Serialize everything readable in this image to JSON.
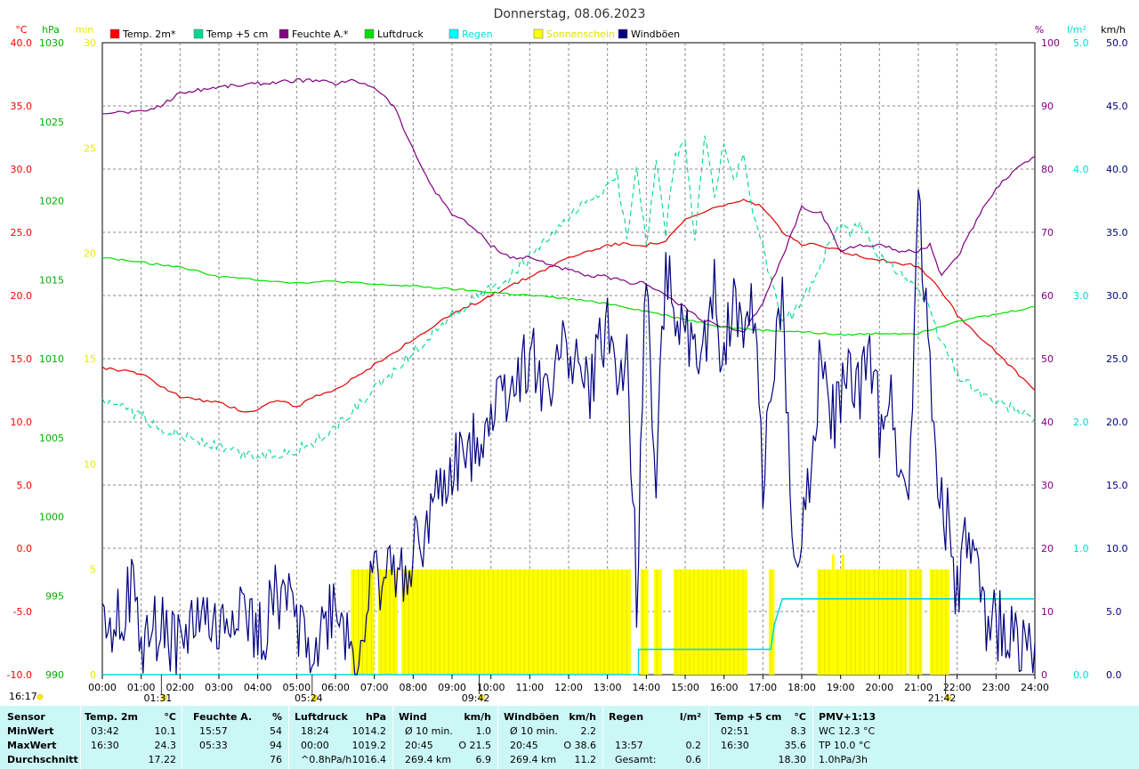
{
  "chart_data": {
    "type": "line",
    "title": "Donnerstag, 08.06.2023",
    "x_ticks": [
      "00:00",
      "01:00",
      "02:00",
      "03:00",
      "04:00",
      "05:00",
      "06:00",
      "07:00",
      "08:00",
      "09:00",
      "10:00",
      "11:00",
      "12:00",
      "13:00",
      "14:00",
      "15:00",
      "16:00",
      "17:00",
      "18:00",
      "19:00",
      "20:00",
      "21:00",
      "22:00",
      "23:00",
      "24:00"
    ],
    "xlim": [
      0,
      24
    ],
    "grid": true,
    "legend_position": "top",
    "axes": {
      "temp": {
        "unit": "°C",
        "ticks": [
          "40.0",
          "35.0",
          "30.0",
          "25.0",
          "20.0",
          "15.0",
          "10.0",
          "5.0",
          "0.0",
          "-5.0",
          "-10.0"
        ],
        "ylim": [
          -10,
          40
        ],
        "color": "#ff0000"
      },
      "pressure": {
        "unit": "hPa",
        "ticks": [
          "1030",
          "1025",
          "1020",
          "1015",
          "1010",
          "1005",
          "1000",
          "995",
          "990"
        ],
        "ylim": [
          990,
          1030
        ],
        "color": "#00b000"
      },
      "sunshine": {
        "unit": "min",
        "ticks": [
          "30",
          "25",
          "20",
          "15",
          "10",
          "5",
          "0"
        ],
        "ylim": [
          0,
          30
        ],
        "color": "#e8e800"
      },
      "humidity": {
        "unit": "%",
        "ticks": [
          "100",
          "90",
          "80",
          "70",
          "60",
          "50",
          "40",
          "30",
          "20",
          "10",
          "0"
        ],
        "ylim": [
          0,
          100
        ],
        "color": "#800080"
      },
      "rain": {
        "unit": "l/m²",
        "ticks": [
          "5.0",
          "4.0",
          "3.0",
          "2.0",
          "1.0",
          "0.0"
        ],
        "ylim": [
          0,
          5
        ],
        "color": "#00d8d8"
      },
      "wind": {
        "unit": "km/h",
        "ticks": [
          "50.0",
          "45.0",
          "40.0",
          "35.0",
          "30.0",
          "25.0",
          "20.0",
          "15.0",
          "10.0",
          "5.0",
          "0.0"
        ],
        "ylim": [
          0,
          50
        ],
        "color": "#000080"
      }
    },
    "legend": [
      {
        "label": "Temp. 2m*",
        "color": "#ff0000"
      },
      {
        "label": "Temp +5 cm",
        "color": "#00d890"
      },
      {
        "label": "Feuchte A.*",
        "color": "#800080"
      },
      {
        "label": "Luftdruck",
        "color": "#00e000"
      },
      {
        "label": "Regen",
        "color": "#00ffff"
      },
      {
        "label": "Sonnenschein",
        "color": "#ffff00"
      },
      {
        "label": "Windböen",
        "color": "#000080"
      }
    ],
    "series": [
      {
        "name": "Temp. 2m*",
        "axis": "temp",
        "x": [
          0,
          1,
          2,
          3,
          3.7,
          4,
          4.5,
          5,
          5.5,
          6,
          7,
          8,
          9,
          10,
          11,
          12,
          13,
          13.5,
          14,
          14.5,
          15,
          16,
          16.5,
          17,
          17.5,
          18,
          18.5,
          19,
          20,
          21,
          21.5,
          22,
          23,
          24
        ],
        "y": [
          14.3,
          13.8,
          12.0,
          11.5,
          10.8,
          11.0,
          11.8,
          11.2,
          12.0,
          12.5,
          14.5,
          16.5,
          18.5,
          20,
          21.5,
          23,
          24,
          24.1,
          24.0,
          24.3,
          26,
          27.2,
          27.5,
          27,
          25,
          24,
          24,
          23.5,
          22.8,
          22.3,
          20.8,
          18.5,
          15.5,
          12.5
        ]
      },
      {
        "name": "Temp +5 cm",
        "axis": "temp",
        "x": [
          0,
          0.5,
          1,
          1.5,
          2,
          2.5,
          3,
          3.5,
          4,
          4.5,
          5,
          5.5,
          6,
          6.5,
          7,
          7.5,
          8,
          8.5,
          9,
          9.5,
          10,
          10.5,
          11,
          11.5,
          12,
          12.5,
          13,
          13.25,
          13.5,
          13.75,
          14,
          14.25,
          14.5,
          14.75,
          15,
          15.25,
          15.5,
          15.75,
          16,
          16.25,
          16.5,
          16.75,
          17,
          17.25,
          17.5,
          17.75,
          18,
          18.25,
          18.5,
          18.75,
          19,
          19.25,
          19.5,
          19.75,
          20,
          20.5,
          21,
          21.25,
          21.5,
          21.75,
          22,
          22.5,
          23,
          23.5,
          24
        ],
        "y": [
          11.5,
          11.0,
          10.5,
          9.5,
          9.0,
          8.5,
          8.0,
          7.5,
          7.3,
          7.5,
          7.8,
          8.5,
          9.5,
          11.0,
          12.5,
          14.0,
          15.5,
          17.0,
          18.5,
          19.5,
          20.5,
          21.5,
          23.0,
          24.5,
          26.0,
          27.5,
          28.5,
          29.5,
          24.5,
          30.5,
          24.0,
          30.5,
          25.0,
          31.0,
          32.0,
          24.5,
          32.5,
          28,
          32.0,
          29,
          31.0,
          26.5,
          24.0,
          20.5,
          18.0,
          18.5,
          19.5,
          21.0,
          22.5,
          24.5,
          25.5,
          25.0,
          25.5,
          24.5,
          23.0,
          22.0,
          20.5,
          19.0,
          17.0,
          15.5,
          13.8,
          12.5,
          11.5,
          11.0,
          10.0
        ]
      },
      {
        "name": "Feuchte A.*",
        "axis": "humidity",
        "x": [
          0,
          0.5,
          1,
          1.5,
          2,
          3,
          4,
          5,
          5.5,
          6,
          6.5,
          7,
          7.5,
          8,
          8.5,
          9,
          9.5,
          10,
          10.5,
          11,
          11.5,
          12,
          12.5,
          13,
          13.5,
          14,
          14.5,
          15,
          15.5,
          16,
          16.5,
          17,
          17.5,
          18,
          18.5,
          19,
          19.5,
          20,
          20.5,
          21,
          21.3,
          21.6,
          22,
          22.5,
          23,
          23.5,
          24
        ],
        "y": [
          89,
          89,
          89,
          90,
          92,
          93,
          93.5,
          94,
          94,
          93.5,
          94,
          93,
          90,
          83,
          77,
          73,
          71,
          68,
          66,
          66,
          65,
          64,
          63,
          63,
          62,
          62,
          60,
          58,
          56,
          55,
          54,
          59,
          66,
          74,
          73,
          67,
          68,
          68,
          67,
          67,
          68,
          63,
          66,
          72,
          77,
          80,
          82
        ]
      },
      {
        "name": "Luftdruck",
        "axis": "pressure",
        "x": [
          0,
          1,
          2,
          3,
          4,
          5,
          6,
          7,
          8,
          9,
          10,
          11,
          12,
          13,
          14,
          15,
          16,
          17,
          18,
          19,
          20,
          21,
          21.5,
          22,
          23,
          24
        ],
        "y": [
          1016.4,
          1016.1,
          1015.8,
          1015.2,
          1015.0,
          1014.8,
          1014.9,
          1014.7,
          1014.6,
          1014.4,
          1014.2,
          1014.0,
          1013.8,
          1013.5,
          1013.0,
          1012.5,
          1012.0,
          1011.8,
          1011.7,
          1011.5,
          1011.6,
          1011.6,
          1012.0,
          1012.4,
          1012.8,
          1013.3
        ]
      },
      {
        "name": "Regen",
        "axis": "rain",
        "x": [
          0,
          13.8,
          13.8,
          17.2,
          17.3,
          17.5,
          24
        ],
        "y": [
          0,
          0,
          0.2,
          0.2,
          0.4,
          0.6,
          0.6
        ]
      },
      {
        "name": "Windböen",
        "axis": "wind",
        "x": [
          0,
          0.5,
          0.8,
          1,
          1.5,
          2,
          2.5,
          3,
          3.5,
          4,
          4.5,
          5,
          5.5,
          6,
          6.3,
          6.5,
          7,
          7.5,
          8,
          8.5,
          9,
          9.5,
          10,
          10.5,
          11,
          11.5,
          12,
          12.5,
          13,
          13.25,
          13.5,
          13.75,
          14,
          14.25,
          14.5,
          14.75,
          15,
          15.25,
          15.5,
          15.75,
          16,
          16.25,
          16.5,
          16.75,
          17,
          17.25,
          17.5,
          17.75,
          18,
          18.25,
          18.5,
          18.75,
          19,
          19.25,
          19.5,
          19.75,
          20,
          20.25,
          20.5,
          20.75,
          21,
          21.25,
          21.5,
          21.75,
          22,
          22.25,
          22.5,
          22.75,
          23,
          23.5,
          24
        ],
        "y": [
          4.5,
          5.0,
          6.5,
          2.0,
          4.0,
          2.0,
          5.0,
          3.0,
          6.0,
          2.5,
          6.5,
          4.5,
          2.0,
          6.0,
          3.0,
          1.0,
          7.5,
          8.0,
          9.5,
          13,
          16,
          18,
          21,
          23,
          25,
          23,
          26,
          22,
          28,
          23,
          25,
          6.5,
          32,
          15,
          34,
          25,
          28,
          24,
          26,
          30,
          24,
          31,
          27,
          29,
          16,
          23,
          29,
          12,
          11,
          18,
          25,
          20,
          22,
          24,
          22,
          25,
          20,
          23,
          17,
          14,
          38.6,
          26,
          16,
          12,
          6,
          11,
          8,
          3,
          4,
          3,
          2.5
        ]
      }
    ],
    "sunshine_bars": [
      [
        6.4,
        7.0
      ],
      [
        7.1,
        7.6
      ],
      [
        7.7,
        13.6
      ],
      [
        13.85,
        14.05
      ],
      [
        14.2,
        14.4
      ],
      [
        14.7,
        16.6
      ],
      [
        17.15,
        17.3
      ],
      [
        18.4,
        19.8
      ],
      [
        19.8,
        20.7
      ],
      [
        20.75,
        21.1
      ],
      [
        21.3,
        21.8
      ]
    ],
    "sunshine_peaks": [
      [
        18.8,
        2
      ],
      [
        19.05,
        2
      ]
    ],
    "sunshine_min": 5,
    "markers": [
      {
        "label": "01:31",
        "x": 1.52
      },
      {
        "label": "05:24",
        "x": 5.4
      },
      {
        "label": "09:42",
        "x": 9.7
      },
      {
        "label": "21:42",
        "x": 21.7
      }
    ],
    "corner_time": "16:17"
  },
  "stats": {
    "rows": [
      "Sensor",
      "MinWert",
      "MaxWert",
      "Durchschnitt"
    ],
    "temp2m": {
      "h1": "Temp. 2m",
      "h2": "°C",
      "min_t": "03:42",
      "min_v": "10.1",
      "max_t": "16:30",
      "max_v": "24.3",
      "avg": "17.22"
    },
    "humidity": {
      "h1": "Feuchte A.",
      "h2": "%",
      "min_t": "15:57",
      "min_v": "54",
      "max_t": "05:33",
      "max_v": "94",
      "avg": "76"
    },
    "pressure": {
      "h1": "Luftdruck",
      "h2": "hPa",
      "min_t": "18:24",
      "min_v": "1014.2",
      "max_t": "00:00",
      "max_v": "1019.2",
      "avg_l": "^0.8hPa/h",
      "avg": "1016.4"
    },
    "wind": {
      "h1": "Wind",
      "h2": "km/h",
      "min_l": "Ø 10 min.",
      "min_v": "1.0",
      "max_t": "20:45",
      "max_v": "O 21.5",
      "avg_l": "269.4 km",
      "avg": "6.9"
    },
    "gusts": {
      "h1": "Windböen",
      "h2": "km/h",
      "min_l": "Ø 10 min.",
      "min_v": "2.2",
      "max_t": "20:45",
      "max_v": "O 38.6",
      "avg_l": "269.4 km",
      "avg": "11.2"
    },
    "rain": {
      "h1": "Regen",
      "h2": "l/m²",
      "max_t": "13:57",
      "max_v": "0.2",
      "avg_l": "Gesamt:",
      "avg": "0.6"
    },
    "temp5": {
      "h1": "Temp +5 cm",
      "h2": "°C",
      "min_t": "02:51",
      "min_v": "8.3",
      "max_t": "16:30",
      "max_v": "35.6",
      "avg": "18.30"
    },
    "pmv": {
      "h1": "PMV+1:13",
      "wc": "WC 12.3 °C",
      "tp": "TP 10.0 °C",
      "rate": "1.0hPa/3h"
    }
  }
}
